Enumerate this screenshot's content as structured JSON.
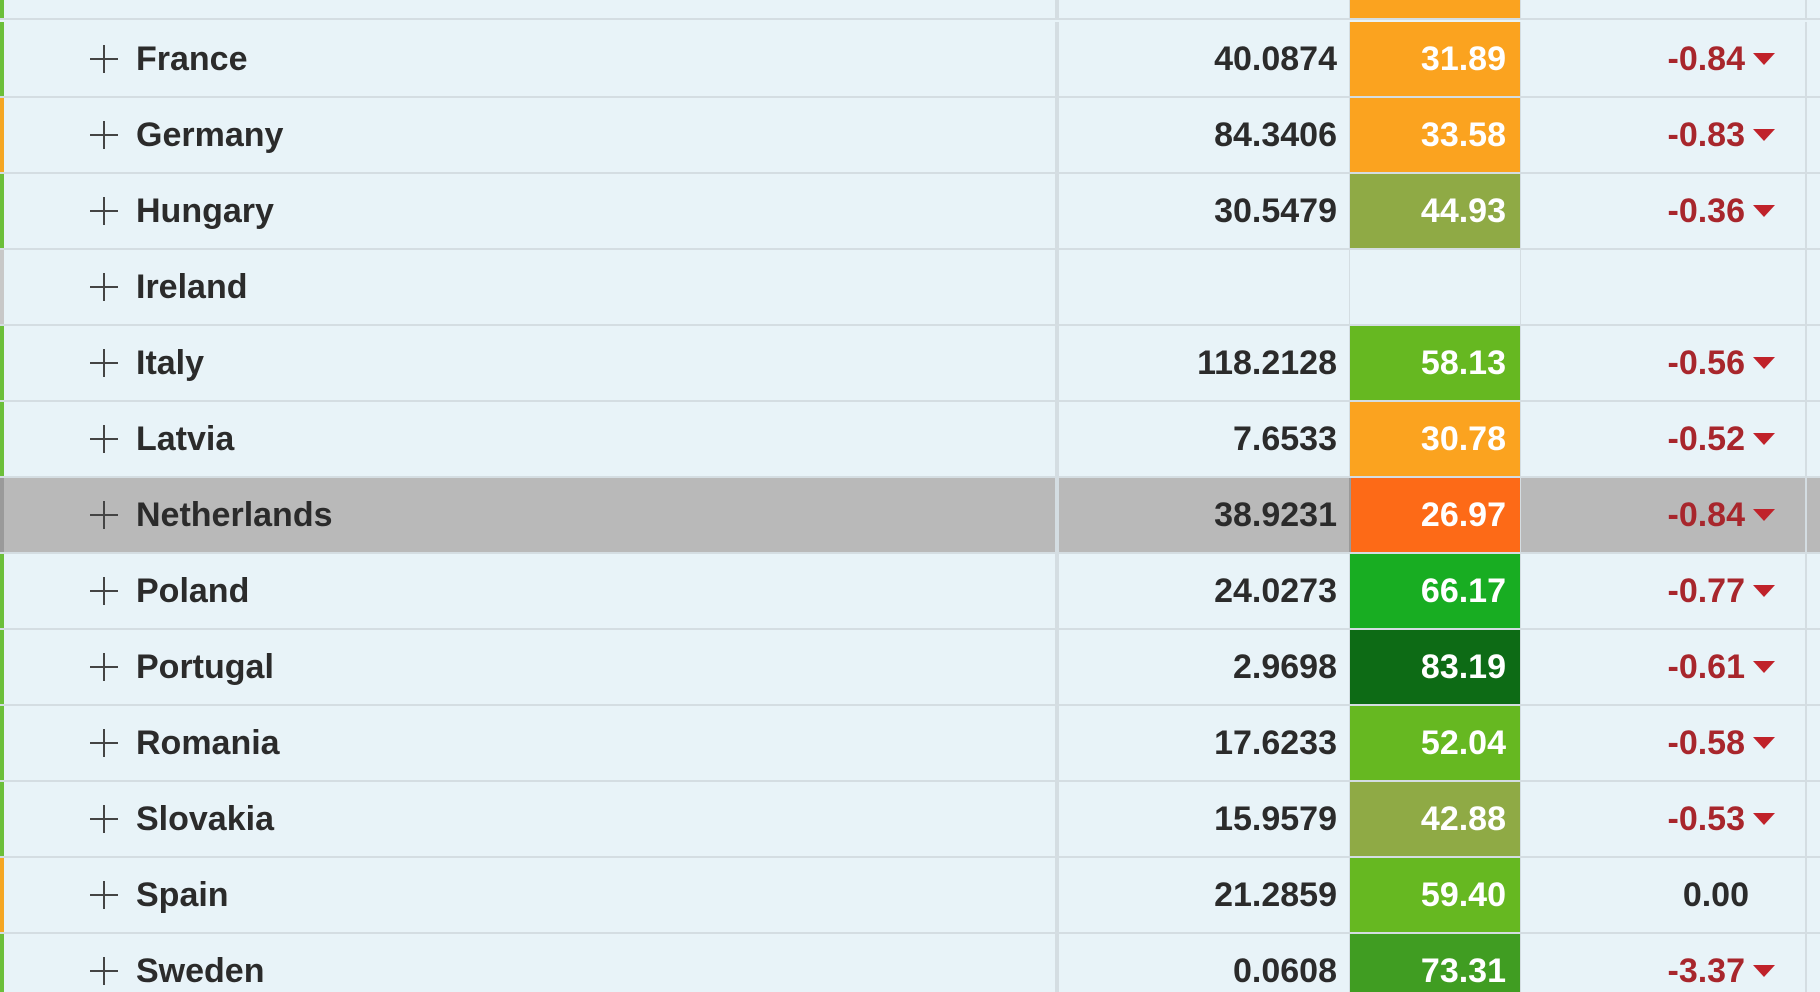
{
  "colors": {
    "negative": "#a8262c",
    "arrow": "#c0222a",
    "row_bg": "#e8f3f8",
    "selected_bg": "#b9b9b9"
  },
  "top_partial": {
    "score_color": "#fba31f",
    "stripe": "#6cbf3a"
  },
  "rows": [
    {
      "name": "France",
      "value": "40.0874",
      "score": "31.89",
      "score_color": "#fba31f",
      "change": "-0.84",
      "direction": "down",
      "stripe": "#6cbf3a"
    },
    {
      "name": "Germany",
      "value": "84.3406",
      "score": "33.58",
      "score_color": "#fba31f",
      "change": "-0.83",
      "direction": "down",
      "stripe": "#f5a623"
    },
    {
      "name": "Hungary",
      "value": "30.5479",
      "score": "44.93",
      "score_color": "#8faa45",
      "change": "-0.36",
      "direction": "down",
      "stripe": "#6cbf3a"
    },
    {
      "name": "Ireland",
      "value": "",
      "score": "",
      "score_color": "",
      "change": "",
      "direction": "none",
      "stripe": "#c8c8c8"
    },
    {
      "name": "Italy",
      "value": "118.2128",
      "score": "58.13",
      "score_color": "#66b821",
      "change": "-0.56",
      "direction": "down",
      "stripe": "#6cbf3a"
    },
    {
      "name": "Latvia",
      "value": "7.6533",
      "score": "30.78",
      "score_color": "#fba31f",
      "change": "-0.52",
      "direction": "down",
      "stripe": "#6cbf3a"
    },
    {
      "name": "Netherlands",
      "value": "38.9231",
      "score": "26.97",
      "score_color": "#fd6a17",
      "change": "-0.84",
      "direction": "down",
      "stripe": "#9a9a9a",
      "selected": true
    },
    {
      "name": "Poland",
      "value": "24.0273",
      "score": "66.17",
      "score_color": "#18ad22",
      "change": "-0.77",
      "direction": "down",
      "stripe": "#6cbf3a"
    },
    {
      "name": "Portugal",
      "value": "2.9698",
      "score": "83.19",
      "score_color": "#0d6b15",
      "change": "-0.61",
      "direction": "down",
      "stripe": "#6cbf3a"
    },
    {
      "name": "Romania",
      "value": "17.6233",
      "score": "52.04",
      "score_color": "#66b821",
      "change": "-0.58",
      "direction": "down",
      "stripe": "#6cbf3a"
    },
    {
      "name": "Slovakia",
      "value": "15.9579",
      "score": "42.88",
      "score_color": "#8faa45",
      "change": "-0.53",
      "direction": "down",
      "stripe": "#6cbf3a"
    },
    {
      "name": "Spain",
      "value": "21.2859",
      "score": "59.40",
      "score_color": "#66b821",
      "change": "0.00",
      "direction": "none",
      "stripe": "#f5a623"
    },
    {
      "name": "Sweden",
      "value": "0.0608",
      "score": "73.31",
      "score_color": "#409d22",
      "change": "-3.37",
      "direction": "down",
      "stripe": "#6cbf3a"
    }
  ]
}
